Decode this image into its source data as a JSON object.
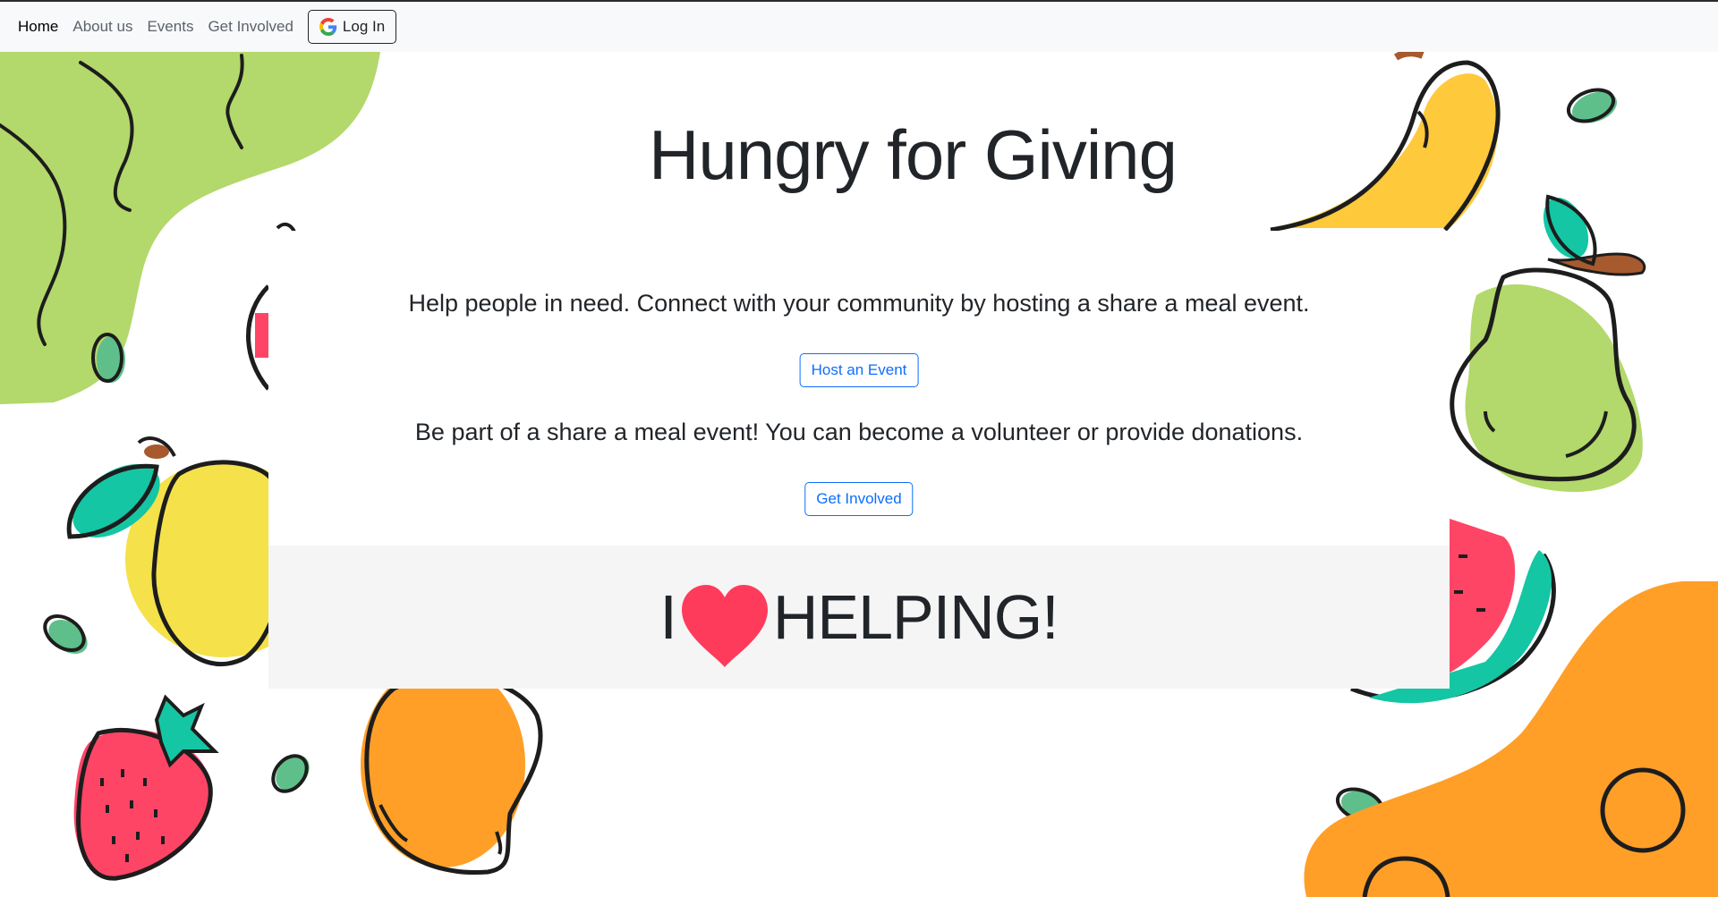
{
  "nav": {
    "items": [
      {
        "label": "Home",
        "active": true
      },
      {
        "label": "About us"
      },
      {
        "label": "Events"
      },
      {
        "label": "Get Involved"
      }
    ],
    "login_label": "Log In",
    "login_icon": "google-icon"
  },
  "hero": {
    "title": "Hungry for Giving"
  },
  "host": {
    "text": "Help people in need. Connect with your community by hosting a share a meal event.",
    "button": "Host an Event"
  },
  "involve": {
    "text": "Be part of a share a meal event! You can become a volunteer or provide donations.",
    "button": "Get Involved"
  },
  "banner": {
    "prefix": "I",
    "icon": "heart-icon",
    "suffix": "HELPING!"
  },
  "colors": {
    "nav_bg": "#f8f9fa",
    "accent_blue": "#0d6efd",
    "heart_red": "#ff3b5c",
    "green": "#b3d86b",
    "orange": "#ff9f27",
    "yellow": "#f5e14a",
    "teal": "#14c6a4"
  }
}
